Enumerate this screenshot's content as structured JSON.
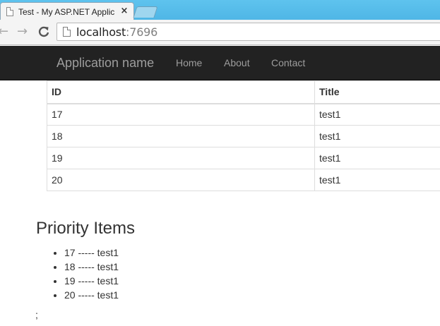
{
  "browser": {
    "tab_title": "Test - My ASP.NET Applic",
    "tab_close": "×",
    "url_host": "localhost",
    "url_port": ":7696",
    "back_glyph": "←",
    "forward_glyph": "→",
    "reload_glyph": "C"
  },
  "navbar": {
    "brand": "Application name",
    "links": [
      "Home",
      "About",
      "Contact"
    ],
    "background": "#222222",
    "link_color": "#9d9d9d"
  },
  "table": {
    "headers": [
      "ID",
      "Title"
    ],
    "rows": [
      [
        "17",
        "test1"
      ],
      [
        "18",
        "test1"
      ],
      [
        "19",
        "test1"
      ],
      [
        "20",
        "test1"
      ]
    ]
  },
  "priority": {
    "heading": "Priority Items",
    "items": [
      "17 ----- test1",
      "18 ----- test1",
      "19 ----- test1",
      "20 ----- test1"
    ]
  },
  "footer_text": ";"
}
